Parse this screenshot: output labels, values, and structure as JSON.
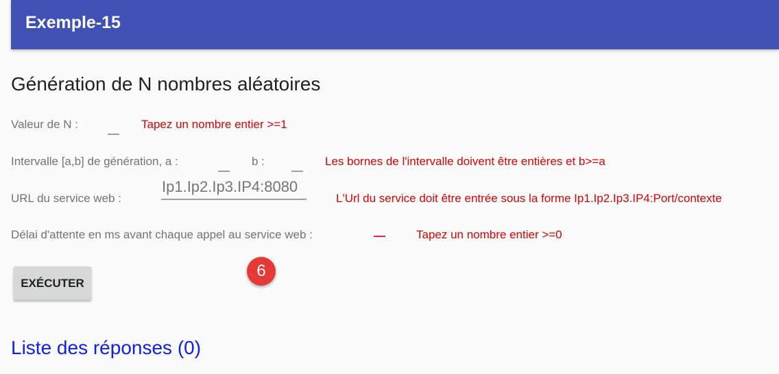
{
  "app_bar": {
    "title": "Exemple-15"
  },
  "form": {
    "heading": "Génération de N nombres aléatoires",
    "n_label": "Valeur de N :",
    "n_value": "",
    "n_error": "Tapez un nombre entier >=1",
    "interval_a_label": "Intervalle [a,b] de génération, a :",
    "a_value": "",
    "interval_b_label": "b :",
    "b_value": "",
    "interval_error": "Les bornes de l'intervalle doivent être entières et b>=a",
    "url_label": "URL du service web :",
    "url_placeholder": "Ip1.Ip2.Ip3.IP4:8080",
    "url_error": "L'Url du service doit être entrée sous la forme Ip1.Ip2.Ip3.IP4:Port/contexte",
    "delay_label": "Délai d'attente en ms avant chaque appel au service web :",
    "delay_value": "",
    "delay_error": "Tapez un nombre entier >=0"
  },
  "actions": {
    "execute_label": "EXÉCUTER"
  },
  "badge": {
    "count": "6"
  },
  "responses": {
    "heading": "Liste des réponses (0)"
  },
  "colors": {
    "app_bar": "#3f51b5",
    "error_text": "#e00000",
    "link_heading": "#0d1ef0",
    "badge": "#e53935",
    "focused_underline": "#e91e63"
  }
}
